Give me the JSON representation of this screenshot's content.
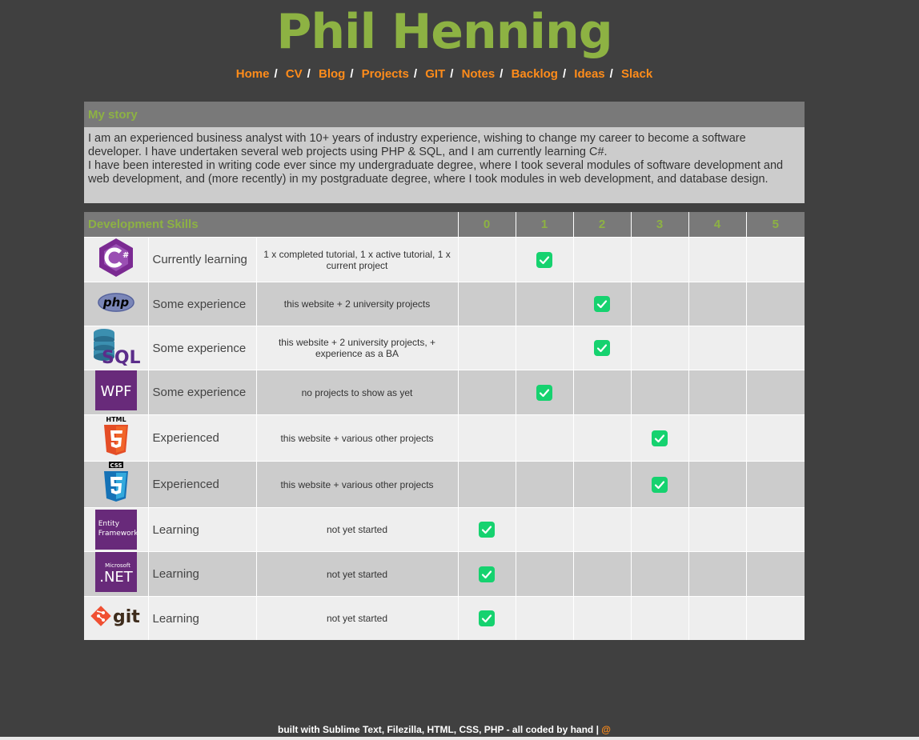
{
  "site": {
    "title": "Phil Henning"
  },
  "nav": {
    "items": [
      "Home",
      "CV",
      "Blog",
      "Projects",
      "GIT",
      "Notes",
      "Backlog",
      "Ideas",
      "Slack"
    ],
    "separator": "/"
  },
  "story": {
    "heading": "My story",
    "paragraph_1": "I am an experienced business analyst with 10+ years of industry experience, wishing to change my career to become a software developer. I have undertaken several web projects using PHP & SQL, and I am currently learning C#.",
    "paragraph_2": "I have been interested in writing code ever since my undergraduate degree, where I took several modules of software development and web development, and (more recently) in my postgraduate degree, where I took modules in web development, and database design."
  },
  "skills": {
    "heading": "Development Skills",
    "rating_columns": [
      "0",
      "1",
      "2",
      "3",
      "4",
      "5"
    ],
    "check_color": "#16d26f",
    "rows": [
      {
        "logo_icon": "csharp-logo-icon",
        "level": "Currently learning",
        "note": "1 x completed tutorial, 1 x active tutorial, 1 x current project",
        "rating": 1
      },
      {
        "logo_icon": "php-logo-icon",
        "logo_text": "php",
        "level": "Some experience",
        "note": "this website + 2 university projects",
        "rating": 2
      },
      {
        "logo_icon": "sql-logo-icon",
        "logo_text": "SQL",
        "level": "Some experience",
        "note": "this website + 2 university projects, + experience as a BA",
        "rating": 2
      },
      {
        "logo_icon": "wpf-logo-icon",
        "logo_text": "WPF",
        "level": "Some experience",
        "note": "no projects to show as yet",
        "rating": 1
      },
      {
        "logo_icon": "html5-logo-icon",
        "logo_text": "HTML",
        "level": "Experienced",
        "note": "this website + various other projects",
        "rating": 3
      },
      {
        "logo_icon": "css3-logo-icon",
        "logo_text": "CSS",
        "level": "Experienced",
        "note": "this website + various other projects",
        "rating": 3
      },
      {
        "logo_icon": "entity-framework-logo-icon",
        "logo_text": "Entity Framework",
        "level": "Learning",
        "note": "not yet started",
        "rating": 0
      },
      {
        "logo_icon": "dotnet-logo-icon",
        "logo_text": ".NET",
        "logo_subtext": "Microsoft",
        "level": "Learning",
        "note": "not yet started",
        "rating": 0
      },
      {
        "logo_icon": "git-logo-icon",
        "logo_text": "git",
        "level": "Learning",
        "note": "not yet started",
        "rating": 0
      }
    ]
  },
  "footer": {
    "text": "built with Sublime Text, Filezilla, HTML, CSS, PHP - all coded by hand | ",
    "link": "@"
  }
}
